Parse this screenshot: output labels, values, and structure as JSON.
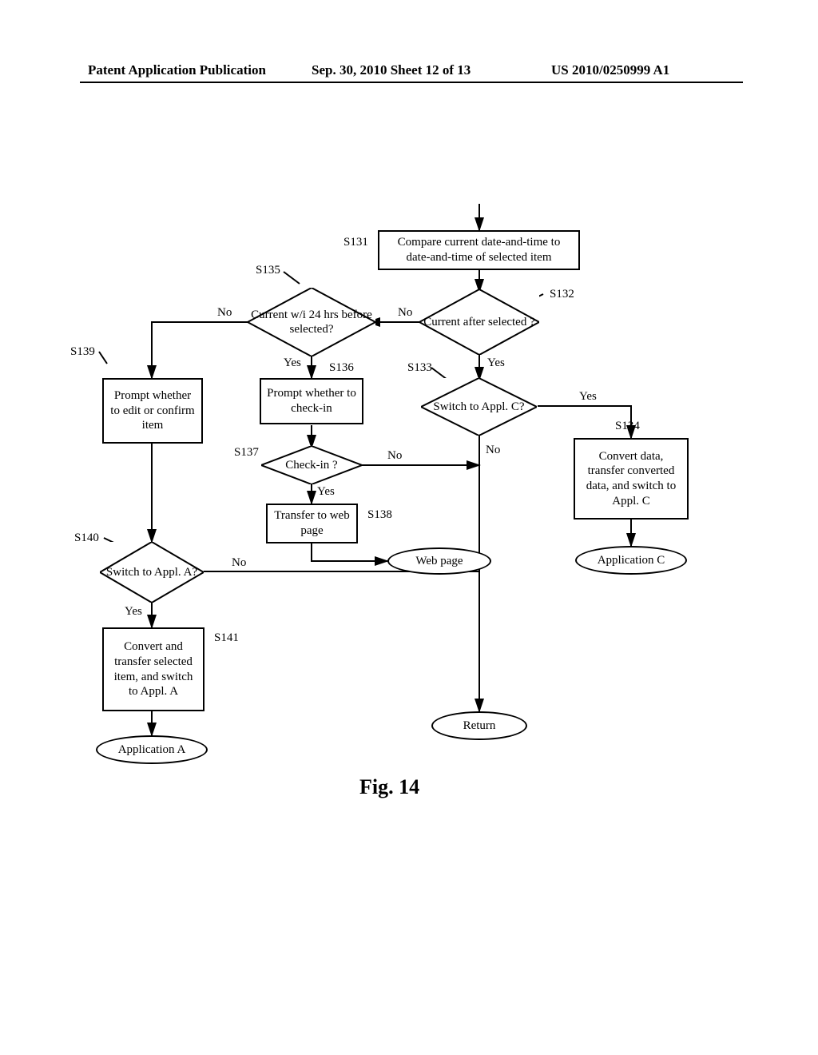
{
  "header": {
    "left": "Patent Application Publication",
    "mid": "Sep. 30, 2010   Sheet 12 of 13",
    "right": "US 2010/0250999 A1"
  },
  "nodes": {
    "s131": "Compare current date-and-time to date-and-time of selected item",
    "s132": "Current after selected ?",
    "s133": "Switch to Appl. C?",
    "s134": "Convert data, transfer converted data, and switch to Appl. C",
    "s135": "Current w/i 24 hrs before selected?",
    "s136": "Prompt whether to check-in",
    "s137": "Check-in ?",
    "s138": "Transfer to web page",
    "s139": "Prompt whether to edit or confirm item",
    "s140": "Switch to Appl. A?",
    "s141": "Convert and transfer selected item, and switch to Appl. A",
    "webpage": "Web page",
    "appC": "Application C",
    "appA": "Application A",
    "return": "Return"
  },
  "step_labels": {
    "s131": "S131",
    "s132": "S132",
    "s133": "S133",
    "s134": "S134",
    "s135": "S135",
    "s136": "S136",
    "s137": "S137",
    "s138": "S138",
    "s139": "S139",
    "s140": "S140",
    "s141": "S141"
  },
  "edge_labels": {
    "yes": "Yes",
    "no": "No"
  },
  "figure_caption": "Fig. 14",
  "chart_data": {
    "type": "flowchart",
    "title": "Fig. 14",
    "nodes": [
      {
        "id": "S131",
        "shape": "process",
        "text": "Compare current date-and-time to date-and-time of selected item"
      },
      {
        "id": "S132",
        "shape": "decision",
        "text": "Current after selected ?"
      },
      {
        "id": "S133",
        "shape": "decision",
        "text": "Switch to Appl. C?"
      },
      {
        "id": "S134",
        "shape": "process",
        "text": "Convert data, transfer converted data, and switch to Appl. C"
      },
      {
        "id": "AppC",
        "shape": "terminator",
        "text": "Application C"
      },
      {
        "id": "S135",
        "shape": "decision",
        "text": "Current w/i 24 hrs before selected?"
      },
      {
        "id": "S136",
        "shape": "process",
        "text": "Prompt whether to check-in"
      },
      {
        "id": "S137",
        "shape": "decision",
        "text": "Check-in ?"
      },
      {
        "id": "S138",
        "shape": "process",
        "text": "Transfer to web page"
      },
      {
        "id": "Web",
        "shape": "terminator",
        "text": "Web page"
      },
      {
        "id": "S139",
        "shape": "process",
        "text": "Prompt whether to edit or confirm item"
      },
      {
        "id": "S140",
        "shape": "decision",
        "text": "Switch to Appl. A?"
      },
      {
        "id": "S141",
        "shape": "process",
        "text": "Convert and transfer selected item, and switch to Appl. A"
      },
      {
        "id": "AppA",
        "shape": "terminator",
        "text": "Application A"
      },
      {
        "id": "Ret",
        "shape": "terminator",
        "text": "Return"
      }
    ],
    "edges": [
      {
        "from": "start",
        "to": "S131"
      },
      {
        "from": "S131",
        "to": "S132"
      },
      {
        "from": "S132",
        "to": "S133",
        "label": "Yes"
      },
      {
        "from": "S132",
        "to": "S135",
        "label": "No"
      },
      {
        "from": "S133",
        "to": "S134",
        "label": "Yes"
      },
      {
        "from": "S133",
        "to": "Ret",
        "label": "No"
      },
      {
        "from": "S134",
        "to": "AppC"
      },
      {
        "from": "S135",
        "to": "S136",
        "label": "Yes"
      },
      {
        "from": "S135",
        "to": "S139",
        "label": "No"
      },
      {
        "from": "S136",
        "to": "S137"
      },
      {
        "from": "S137",
        "to": "S138",
        "label": "Yes"
      },
      {
        "from": "S137",
        "to": "Ret",
        "label": "No"
      },
      {
        "from": "S138",
        "to": "Web"
      },
      {
        "from": "S139",
        "to": "S140"
      },
      {
        "from": "S140",
        "to": "S141",
        "label": "Yes"
      },
      {
        "from": "S140",
        "to": "Ret",
        "label": "No"
      },
      {
        "from": "S141",
        "to": "AppA"
      }
    ]
  }
}
